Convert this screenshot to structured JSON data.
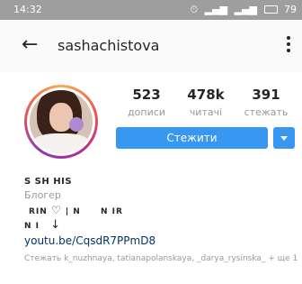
{
  "status_bar": {
    "time": "14:32",
    "battery": "79"
  },
  "header": {
    "back_icon": "arrow-left-icon",
    "username": "sashachistova",
    "more_icon": "vertical-dots-icon"
  },
  "profile": {
    "avatar": "profile-photo",
    "stats": [
      {
        "value": "523",
        "label": "дописи"
      },
      {
        "value": "478k",
        "label": "читачі"
      },
      {
        "value": "391",
        "label": "стежать"
      }
    ],
    "follow_label": "Стежити",
    "dropdown_icon": "caret-down-icon"
  },
  "bio": {
    "name": "S SH HIS",
    "category": "Блогер",
    "line3_a": "RIN",
    "line3_b": "|  N",
    "line3_c": "N IR",
    "line4_a": "N  I",
    "link": "youtu.be/CqsdR7PPmD8",
    "followed_by": "Стежать k_nuzhnaya, tatianapolanskaya, _darya_rysinska_ + ще 1"
  },
  "colors": {
    "accent": "#3897f0",
    "status_bar": "#9e9e9e",
    "link": "#003569",
    "muted": "#999999"
  }
}
